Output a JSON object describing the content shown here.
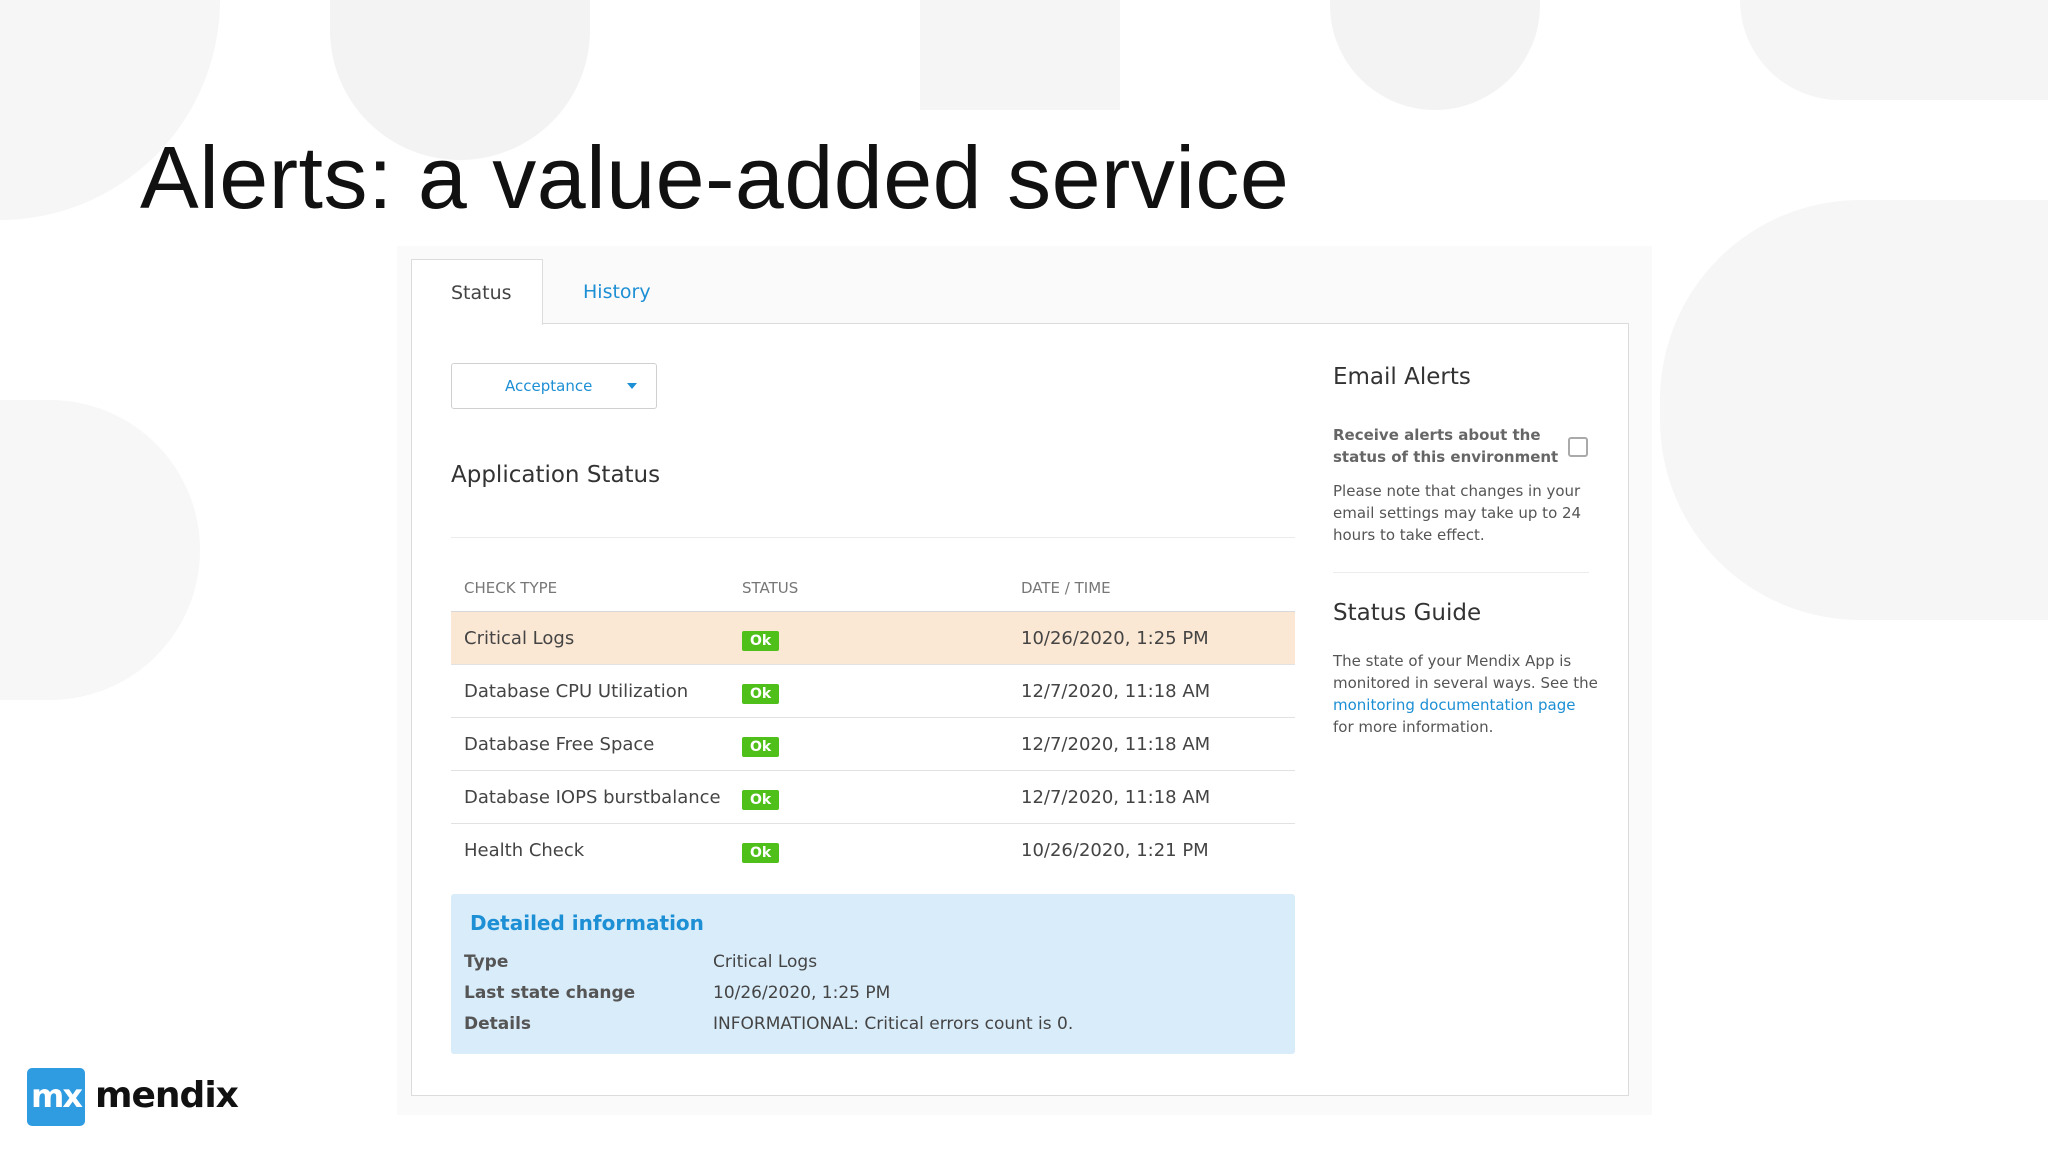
{
  "slide": {
    "title": "Alerts: a value-added service"
  },
  "tabs": {
    "status": "Status",
    "history": "History"
  },
  "environment_select": {
    "value": "Acceptance"
  },
  "application_status": {
    "title": "Application Status",
    "columns": [
      "CHECK TYPE",
      "STATUS",
      "DATE / TIME"
    ],
    "rows": [
      {
        "check_type": "Critical Logs",
        "status": "Ok",
        "date_time": "10/26/2020, 1:25 PM",
        "selected": true
      },
      {
        "check_type": "Database CPU Utilization",
        "status": "Ok",
        "date_time": "12/7/2020, 11:18 AM"
      },
      {
        "check_type": "Database Free Space",
        "status": "Ok",
        "date_time": "12/7/2020, 11:18 AM"
      },
      {
        "check_type": "Database IOPS burstbalance",
        "status": "Ok",
        "date_time": "12/7/2020, 11:18 AM"
      },
      {
        "check_type": "Health Check",
        "status": "Ok",
        "date_time": "10/26/2020, 1:21 PM"
      }
    ]
  },
  "detailed_information": {
    "title": "Detailed information",
    "type_label": "Type",
    "type_value": "Critical Logs",
    "last_change_label": "Last state change",
    "last_change_value": "10/26/2020, 1:25 PM",
    "details_label": "Details",
    "details_value": "INFORMATIONAL: Critical errors count is 0."
  },
  "email_alerts": {
    "title": "Email Alerts",
    "checkbox_label": "Receive alerts about the status of this environment",
    "checked": false,
    "note": "Please note that changes in your email settings may take up to 24 hours to take effect."
  },
  "status_guide": {
    "title": "Status Guide",
    "text_before": "The state of your Mendix App is monitored in several ways. See the",
    "link": "monitoring documentation page",
    "text_after": "for more information."
  },
  "brand": {
    "logo_mark": "mx",
    "logo_word": "mendix",
    "accent_color": "#1d8fd4",
    "ok_color": "#4fbf19",
    "selected_row_color": "#fbe8d4"
  }
}
